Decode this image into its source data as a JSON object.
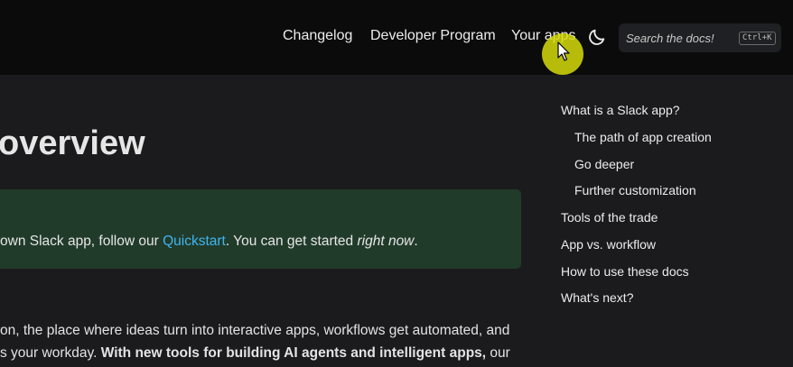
{
  "header": {
    "nav": [
      {
        "label": "Changelog"
      },
      {
        "label": "Developer Program"
      },
      {
        "label": "Your apps"
      }
    ],
    "theme_toggle_icon": "moon-icon",
    "search": {
      "placeholder": "Search the docs!",
      "shortcut": "Ctrl+K"
    }
  },
  "main": {
    "title": "overview",
    "tip": {
      "before": "own Slack app, follow our ",
      "link": "Quickstart",
      "middle": ". You can get started ",
      "italic": "right now",
      "after": "."
    },
    "body": {
      "line1": "on, the place where ideas turn into interactive apps, workflows get automated, and",
      "line2_before": "s your workday. ",
      "line2_bold": "With new tools for building AI agents and intelligent apps,",
      "line2_after": " our"
    }
  },
  "toc": {
    "items": [
      {
        "label": "What is a Slack app?"
      },
      {
        "label": "The path of app creation"
      },
      {
        "label": "Go deeper"
      },
      {
        "label": "Further customization"
      },
      {
        "label": "Tools of the trade"
      },
      {
        "label": "App vs. workflow"
      },
      {
        "label": "How to use these docs"
      },
      {
        "label": "What's next?"
      }
    ]
  },
  "colors": {
    "header_bg": "#0b0b0b",
    "page_bg": "#1b1b1d",
    "tip_bg": "#213b2a",
    "link": "#3fb5f0",
    "cursor_halo": "#d6dc0a"
  }
}
